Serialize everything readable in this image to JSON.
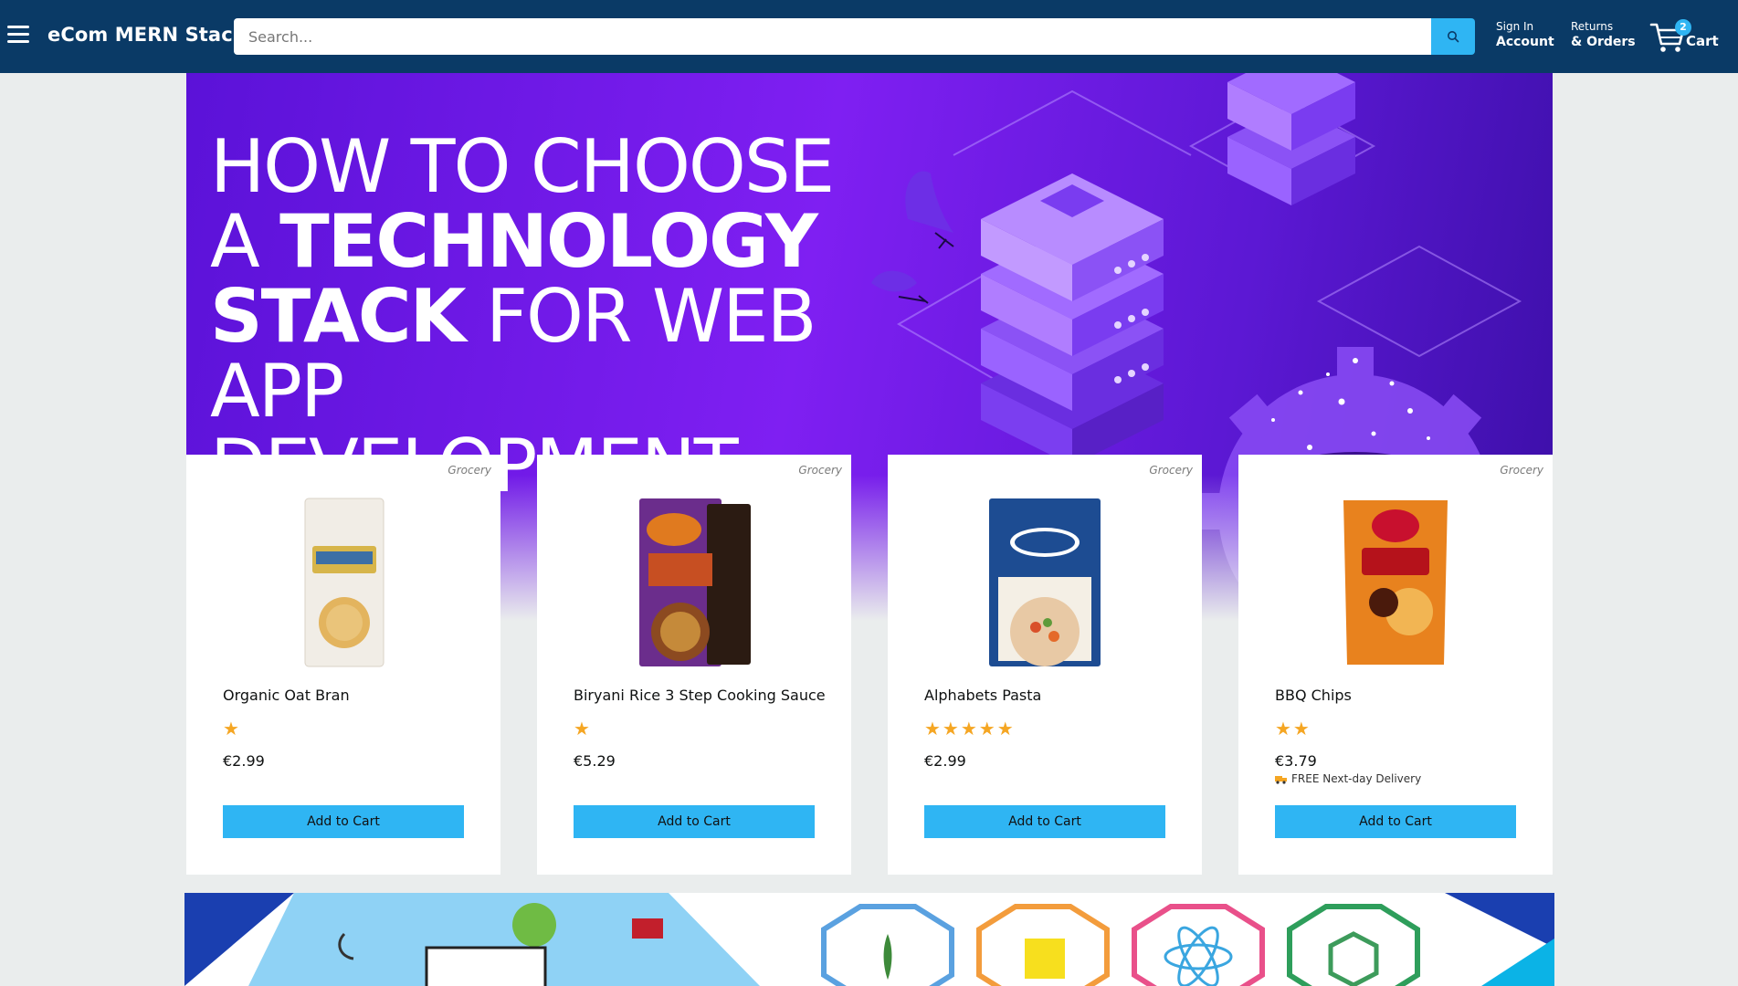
{
  "header": {
    "brand": "eCom MERN Stack",
    "search_placeholder": "Search...",
    "sign_in_line1": "Sign In",
    "sign_in_line2": "Account",
    "returns_line1": "Returns",
    "returns_line2": "& Orders",
    "cart_count": "2",
    "cart_label": "Cart"
  },
  "hero": {
    "line1": "HOW TO CHOOSE",
    "line2a": "A ",
    "line2b": "TECHNOLOGY",
    "line3a": "STACK",
    "line3b": " FOR WEB",
    "line4": "APP DEVELOPMENT"
  },
  "products": [
    {
      "category": "Grocery",
      "name": "Organic Oat Bran",
      "stars": "★",
      "rating": 1,
      "price": "€2.99",
      "button": "Add to Cart"
    },
    {
      "category": "Grocery",
      "name": "Biryani Rice 3 Step Cooking Sauce",
      "stars": "★",
      "rating": 1,
      "price": "€5.29",
      "button": "Add to Cart"
    },
    {
      "category": "Grocery",
      "name": "Alphabets Pasta",
      "stars": "★★★★★",
      "rating": 5,
      "price": "€2.99",
      "button": "Add to Cart"
    },
    {
      "category": "Grocery",
      "name": "BBQ Chips",
      "stars": "★★",
      "rating": 2,
      "price": "€3.79",
      "delivery": "FREE Next-day Delivery",
      "button": "Add to Cart"
    }
  ],
  "colors": {
    "header_bg": "#0a3a66",
    "accent": "#2fb5f3",
    "star": "#f5a623",
    "hero_purple": "#7f1ff2"
  }
}
